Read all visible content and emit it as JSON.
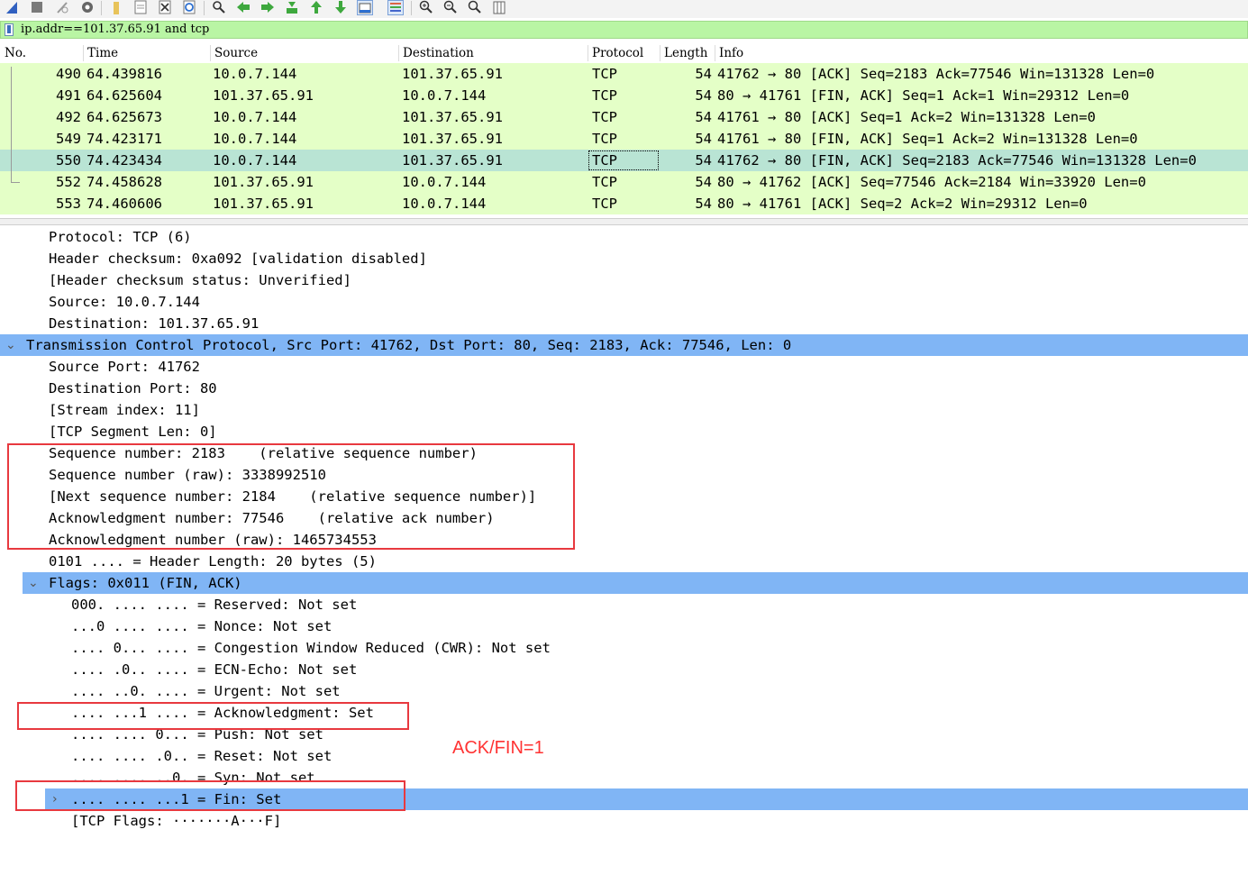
{
  "filter": {
    "value": "ip.addr==101.37.65.91 and tcp"
  },
  "toolbar": {
    "icons": [
      "shark-fin-icon",
      "stop-square-icon",
      "restart-icon",
      "options-gear-icon",
      "open-folder-icon",
      "file-icon",
      "close-file-icon",
      "reload-icon",
      "find-icon",
      "go-back-icon",
      "go-forward-icon",
      "go-to-packet-icon",
      "go-first-icon",
      "go-last-icon",
      "autoscroll-icon",
      "colorize-icon",
      "zoom-in-icon",
      "zoom-out-icon",
      "zoom-normal-icon",
      "resize-columns-icon"
    ]
  },
  "packet_list": {
    "columns": [
      "No.",
      "Time",
      "Source",
      "Destination",
      "Protocol",
      "Length",
      "Info"
    ],
    "rows": [
      {
        "no": "490",
        "time": "64.439816",
        "src": "10.0.7.144",
        "dst": "101.37.65.91",
        "proto": "TCP",
        "len": "54",
        "info": "41762 → 80 [ACK] Seq=2183 Ack=77546 Win=131328 Len=0"
      },
      {
        "no": "491",
        "time": "64.625604",
        "src": "101.37.65.91",
        "dst": "10.0.7.144",
        "proto": "TCP",
        "len": "54",
        "info": "80 → 41761 [FIN, ACK] Seq=1 Ack=1 Win=29312 Len=0"
      },
      {
        "no": "492",
        "time": "64.625673",
        "src": "10.0.7.144",
        "dst": "101.37.65.91",
        "proto": "TCP",
        "len": "54",
        "info": "41761 → 80 [ACK] Seq=1 Ack=2 Win=131328 Len=0"
      },
      {
        "no": "549",
        "time": "74.423171",
        "src": "10.0.7.144",
        "dst": "101.37.65.91",
        "proto": "TCP",
        "len": "54",
        "info": "41761 → 80 [FIN, ACK] Seq=1 Ack=2 Win=131328 Len=0"
      },
      {
        "no": "550",
        "time": "74.423434",
        "src": "10.0.7.144",
        "dst": "101.37.65.91",
        "proto": "TCP",
        "len": "54",
        "info": "41762 → 80 [FIN, ACK] Seq=2183 Ack=77546 Win=131328 Len=0"
      },
      {
        "no": "552",
        "time": "74.458628",
        "src": "101.37.65.91",
        "dst": "10.0.7.144",
        "proto": "TCP",
        "len": "54",
        "info": "80 → 41762 [ACK] Seq=77546 Ack=2184 Win=33920 Len=0"
      },
      {
        "no": "553",
        "time": "74.460606",
        "src": "101.37.65.91",
        "dst": "10.0.7.144",
        "proto": "TCP",
        "len": "54",
        "info": "80 → 41761 [ACK] Seq=2 Ack=2 Win=29312 Len=0"
      }
    ],
    "selected_no": "550"
  },
  "details": {
    "rows": [
      "Protocol: TCP (6)",
      "Header checksum: 0xa092 [validation disabled]",
      "[Header checksum status: Unverified]",
      "Source: 10.0.7.144",
      "Destination: 101.37.65.91",
      "Transmission Control Protocol, Src Port: 41762, Dst Port: 80, Seq: 2183, Ack: 77546, Len: 0",
      "Source Port: 41762",
      "Destination Port: 80",
      "[Stream index: 11]",
      "[TCP Segment Len: 0]",
      "Sequence number: 2183    (relative sequence number)",
      "Sequence number (raw): 3338992510",
      "[Next sequence number: 2184    (relative sequence number)]",
      "Acknowledgment number: 77546    (relative ack number)",
      "Acknowledgment number (raw): 1465734553",
      "0101 .... = Header Length: 20 bytes (5)",
      "Flags: 0x011 (FIN, ACK)",
      "000. .... .... = Reserved: Not set",
      "...0 .... .... = Nonce: Not set",
      ".... 0... .... = Congestion Window Reduced (CWR): Not set",
      ".... .0.. .... = ECN-Echo: Not set",
      ".... ..0. .... = Urgent: Not set",
      ".... ...1 .... = Acknowledgment: Set",
      ".... .... 0... = Push: Not set",
      ".... .... .0.. = Reset: Not set",
      ".... .... ..0. = Syn: Not set",
      ".... .... ...1 = Fin: Set",
      "[TCP Flags: ·······A···F]"
    ]
  },
  "annotation": "ACK/FIN=1",
  "colors": {
    "filter_bg": "#b9f5a4",
    "row_bg": "#e4ffc7",
    "row_selected": "#b9e4d4",
    "detail_highlight": "#80b5f5",
    "annotation_red": "#e8393f"
  }
}
